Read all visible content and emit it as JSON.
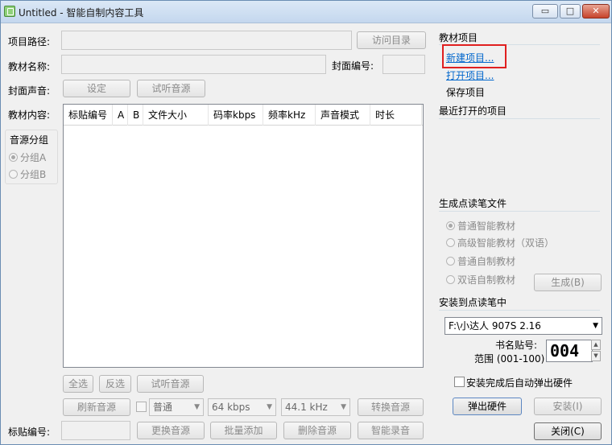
{
  "window": {
    "title": "Untitled - 智能自制内容工具",
    "min": "▭",
    "max": "□",
    "close": "✕"
  },
  "form": {
    "project_path_label": "项目路径:",
    "browse_dir_btn": "访问目录",
    "material_name_label": "教材名称:",
    "cover_no_label": "封面编号:",
    "cover_sound_label": "封面声音:",
    "set_btn": "设定",
    "preview_audio_btn": "试听音源",
    "content_label": "教材内容:",
    "audio_group_title": "音源分组",
    "group_a": "分组A",
    "group_b": "分组B",
    "sticker_no_label": "标贴编号:"
  },
  "table": {
    "columns": [
      "标贴编号",
      "A",
      "B",
      "文件大小",
      "码率kbps",
      "频率kHz",
      "声音模式",
      "时长"
    ]
  },
  "bottom": {
    "select_all": "全选",
    "invert": "反选",
    "preview": "试听音源",
    "refresh": "刷新音源",
    "mode_combo": "普通",
    "bitrate_combo": "64 kbps",
    "freq_combo": "44.1 kHz",
    "convert": "转换音源",
    "replace": "更换音源",
    "batch_add": "批量添加",
    "delete": "删除音源",
    "smart_record": "智能录音"
  },
  "right": {
    "material_project_title": "教材项目",
    "new_project": "新建项目...",
    "open_project": "打开项目...",
    "save_project": "保存项目",
    "recent_title": "最近打开的项目",
    "generate_title": "生成点读笔文件",
    "opt1": "普通智能教材",
    "opt2": "高级智能教材（双语）",
    "opt3": "普通自制教材",
    "opt4": "双语自制教材",
    "generate_btn": "生成(B)",
    "install_title": "安装到点读笔中",
    "device_combo": "F:\\小达人 907S 2.16",
    "book_label": "书名贴号:",
    "range_label": "范围 (001-100)",
    "counter_value": "004",
    "auto_eject_label": "安装完成后自动弹出硬件",
    "eject_btn": "弹出硬件",
    "install_btn": "安装(I)",
    "close_btn": "关闭(C)"
  }
}
